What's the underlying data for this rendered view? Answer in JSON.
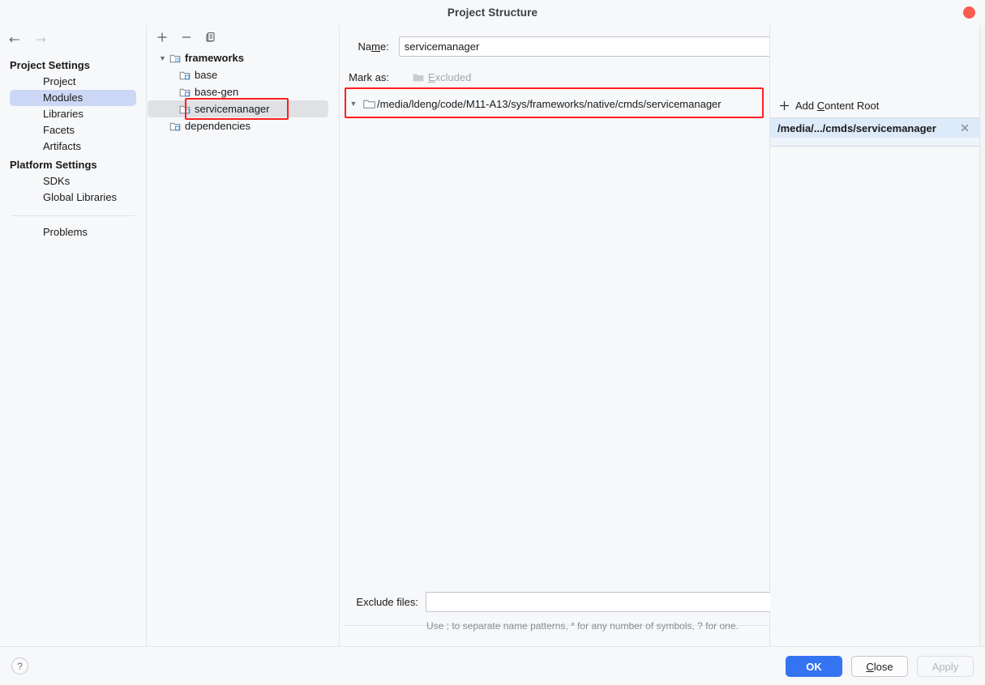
{
  "window": {
    "title": "Project Structure",
    "close_icon": "close-dot-icon"
  },
  "nav": {
    "back_icon": "arrow-left-icon",
    "forward_icon": "arrow-right-icon"
  },
  "sidebar": {
    "groups": [
      {
        "heading": "Project Settings",
        "items": [
          {
            "label": "Project",
            "selected": false
          },
          {
            "label": "Modules",
            "selected": true
          },
          {
            "label": "Libraries",
            "selected": false
          },
          {
            "label": "Facets",
            "selected": false
          },
          {
            "label": "Artifacts",
            "selected": false
          }
        ]
      },
      {
        "heading": "Platform Settings",
        "items": [
          {
            "label": "SDKs",
            "selected": false
          },
          {
            "label": "Global Libraries",
            "selected": false
          }
        ]
      }
    ],
    "problems_label": "Problems"
  },
  "tree_panel": {
    "toolbar": [
      {
        "name": "add-module-button",
        "glyph": "+"
      },
      {
        "name": "remove-module-button",
        "glyph": "−"
      },
      {
        "name": "copy-module-button",
        "glyph": "copy-icon"
      }
    ],
    "nodes": [
      {
        "label": "frameworks",
        "indent": 0,
        "expanded": true,
        "bold": true,
        "selected": false
      },
      {
        "label": "base",
        "indent": 1,
        "expanded": false,
        "bold": false,
        "selected": false
      },
      {
        "label": "base-gen",
        "indent": 1,
        "expanded": false,
        "bold": false,
        "selected": false
      },
      {
        "label": "servicemanager",
        "indent": 1,
        "expanded": false,
        "bold": false,
        "selected": true
      },
      {
        "label": "dependencies",
        "indent": 0,
        "expanded": false,
        "bold": false,
        "selected": false
      }
    ]
  },
  "main": {
    "name_label": "Name:",
    "name_label_mnemonic": "m",
    "name_value": "servicemanager",
    "name_placeholder": "",
    "mark_as_label": "Mark as:",
    "excluded_label": "Excluded",
    "excluded_mnemonic": "E",
    "content_root_path": "/media/ldeng/code/M11-A13/sys/frameworks/native/cmds/servicemanager",
    "exclude_files_label": "Exclude files:",
    "exclude_files_value": "",
    "exclude_files_placeholder": "",
    "exclude_hint": "Use ; to separate name patterns, * for any number of symbols, ? for one."
  },
  "content_roots": {
    "add_label": "Add Content Root",
    "add_mnemonic": "C",
    "items": [
      {
        "label": "/media/.../cmds/servicemanager",
        "selected": true,
        "remove_icon": "close-x-icon"
      }
    ]
  },
  "footer": {
    "help_label": "?",
    "ok_label": "OK",
    "close_label": "Close",
    "close_mnemonic": "C",
    "apply_label": "Apply",
    "apply_enabled": false
  },
  "colors": {
    "accent_blue": "#3574f0",
    "selection_blue": "#ccd7f5",
    "row_selection_grey": "#dfe1e5",
    "root_selected_blue": "#ddeaf9",
    "annotation_red": "#ff1e1e",
    "close_dot_red": "#fc5b51",
    "background": "#f7f8fa"
  }
}
